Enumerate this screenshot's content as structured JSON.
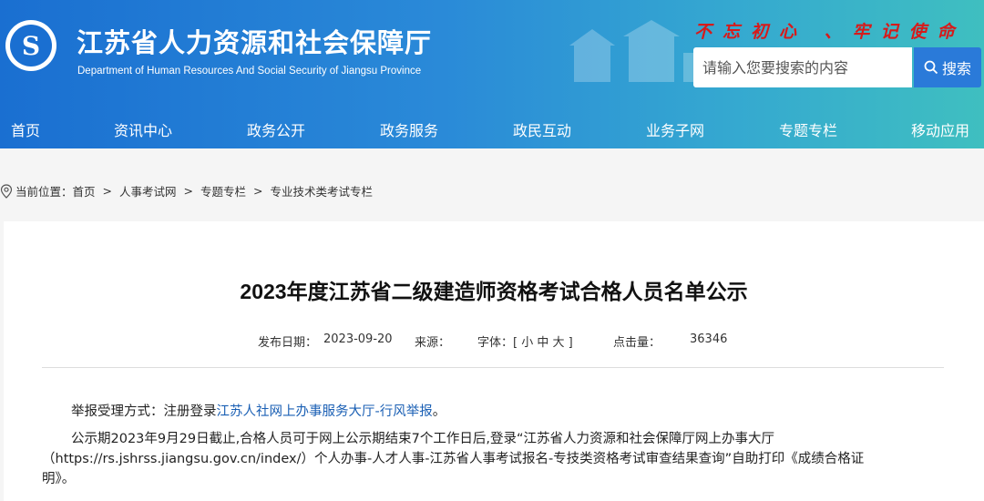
{
  "header": {
    "title": "江苏省人力资源和社会保障厅",
    "subtitle": "Department of Human Resources And Social Security of Jiangsu Province",
    "slogan": "不忘初心 、牢记使命",
    "search_placeholder": "请输入您要搜索的内容",
    "search_label": "搜索"
  },
  "nav": [
    "首页",
    "资讯中心",
    "政务公开",
    "政务服务",
    "政民互动",
    "业务子网",
    "专题专栏",
    "移动应用"
  ],
  "nav_active": "业务子网",
  "breadcrumb": {
    "prefix": "当前位置：",
    "items": [
      "首页",
      "人事考试网",
      "专题专栏",
      "专业技术类考试专栏"
    ],
    "separator": ">"
  },
  "article": {
    "title": "2023年度江苏省二级建造师资格考试合格人员名单公示",
    "meta": {
      "date_label": "发布日期：",
      "date": "2023-09-20",
      "source_label": "来源：",
      "font_label": "字体：[ 小 中 大 ]",
      "views_label": "点击量：",
      "views": "36346"
    },
    "p1_prefix": "举报受理方式：注册登录",
    "p1_link": "江苏人社网上办事服务大厅-行风举报",
    "p1_suffix": "。",
    "p2_line1": "公示期2023年9月29日截止,合格人员可于网上公示期结束7个工作日后,登录“江苏省人力资源和社会保障厅网上办事大厅",
    "p2_line2": "（https://rs.jshrss.jiangsu.gov.cn/index/）个人办事-人才人事-江苏省人事考试报名-专技类资格考试审查结果查询”自助打印《成绩合格证",
    "p2_line3": "明》。"
  },
  "colors": {
    "header_start": "#1a6fd1",
    "header_end": "#3fbfc0",
    "slogan": "#d71a1a",
    "link": "#1a5fb4"
  }
}
